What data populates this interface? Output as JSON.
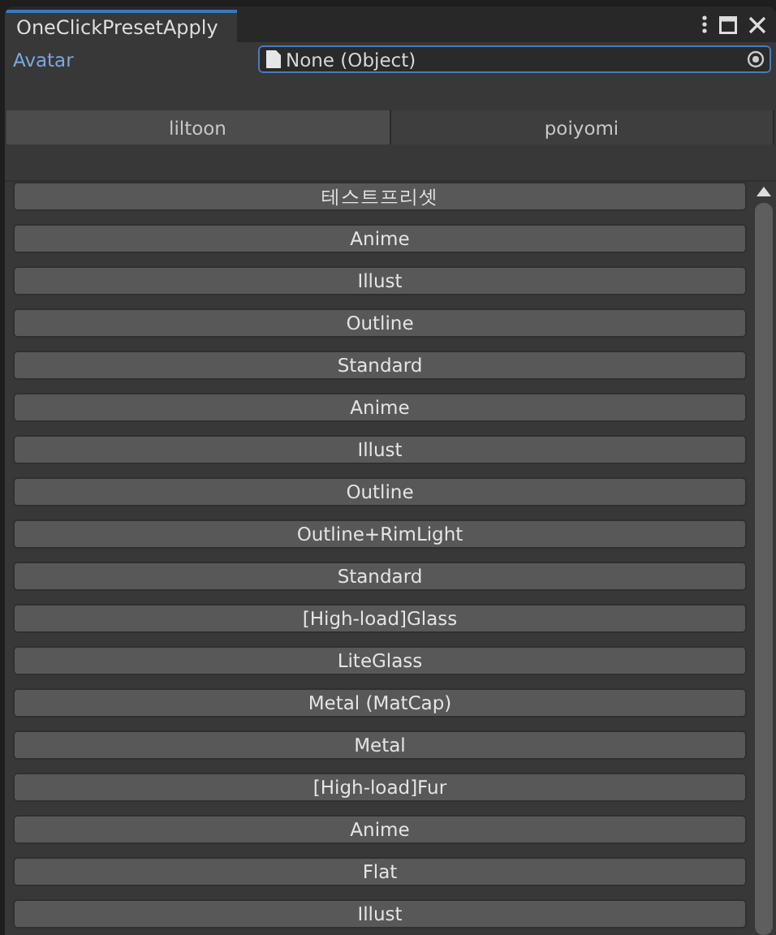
{
  "window": {
    "title": "OneClickPresetApply"
  },
  "avatar": {
    "label": "Avatar",
    "value": "None (Object)"
  },
  "tabs": [
    {
      "label": "liltoon",
      "selected": true
    },
    {
      "label": "poiyomi",
      "selected": false
    }
  ],
  "presets": [
    "테스트프리셋",
    "Anime",
    "Illust",
    "Outline",
    "Standard",
    "Anime",
    "Illust",
    "Outline",
    "Outline+RimLight",
    "Standard",
    "[High-load]Glass",
    "LiteGlass",
    "Metal (MatCap)",
    "Metal",
    "[High-load]Fur",
    "Anime",
    "Flat",
    "Illust"
  ]
}
